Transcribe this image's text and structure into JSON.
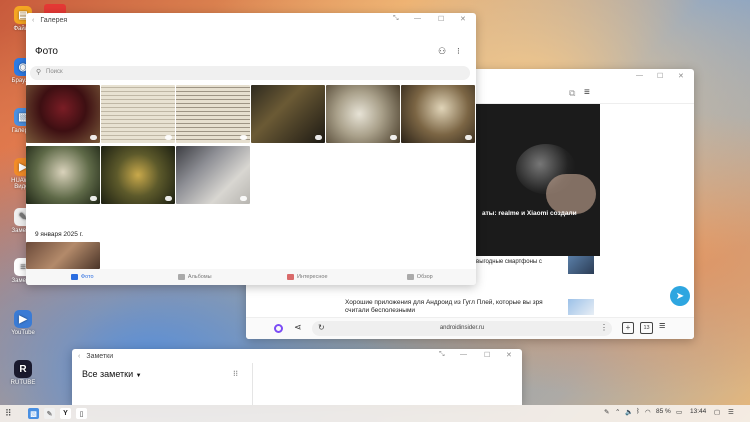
{
  "desktop": {
    "icons": [
      {
        "label": "Файлы",
        "color": "#f5a623",
        "glyph": "▤"
      },
      {
        "label": "Браузер",
        "color": "#2d7be5",
        "glyph": "◉"
      },
      {
        "label": "Галерея",
        "color": "#4a90e2",
        "glyph": "▧"
      },
      {
        "label": "HUAWEI Видео",
        "color": "#f28c28",
        "glyph": "▶"
      },
      {
        "label": "Заметки",
        "color": "#f0f0f0",
        "glyph": "✎"
      },
      {
        "label": "Заметки",
        "color": "#ffffff",
        "glyph": "≡"
      },
      {
        "label": "YouTube",
        "color": "#3a7bd5",
        "glyph": "▶"
      },
      {
        "label": "RUTUBE",
        "color": "#1a1a2e",
        "glyph": "R"
      }
    ]
  },
  "gallery": {
    "window_title": "Галерея",
    "page_title": "Фото",
    "search_placeholder": "Поиск",
    "date_label": "9 января 2025 г.",
    "tabs": [
      "Фото",
      "Альбомы",
      "Интересное",
      "Обзор"
    ],
    "colors": {
      "accent": "#2b6de0"
    }
  },
  "browser": {
    "hero_caption": "аты: realme и Xiaomi создали",
    "articles": [
      "выгодные смартфоны с",
      "Хорошие приложения для Андроид из Гугл Плей, которые вы зря считали бесполезными"
    ],
    "url": "androidinsider.ru",
    "tab_count": "13"
  },
  "notes": {
    "window_title": "Заметки",
    "heading": "Все заметки"
  },
  "taskbar": {
    "battery": "85 %",
    "time": "13:44"
  }
}
